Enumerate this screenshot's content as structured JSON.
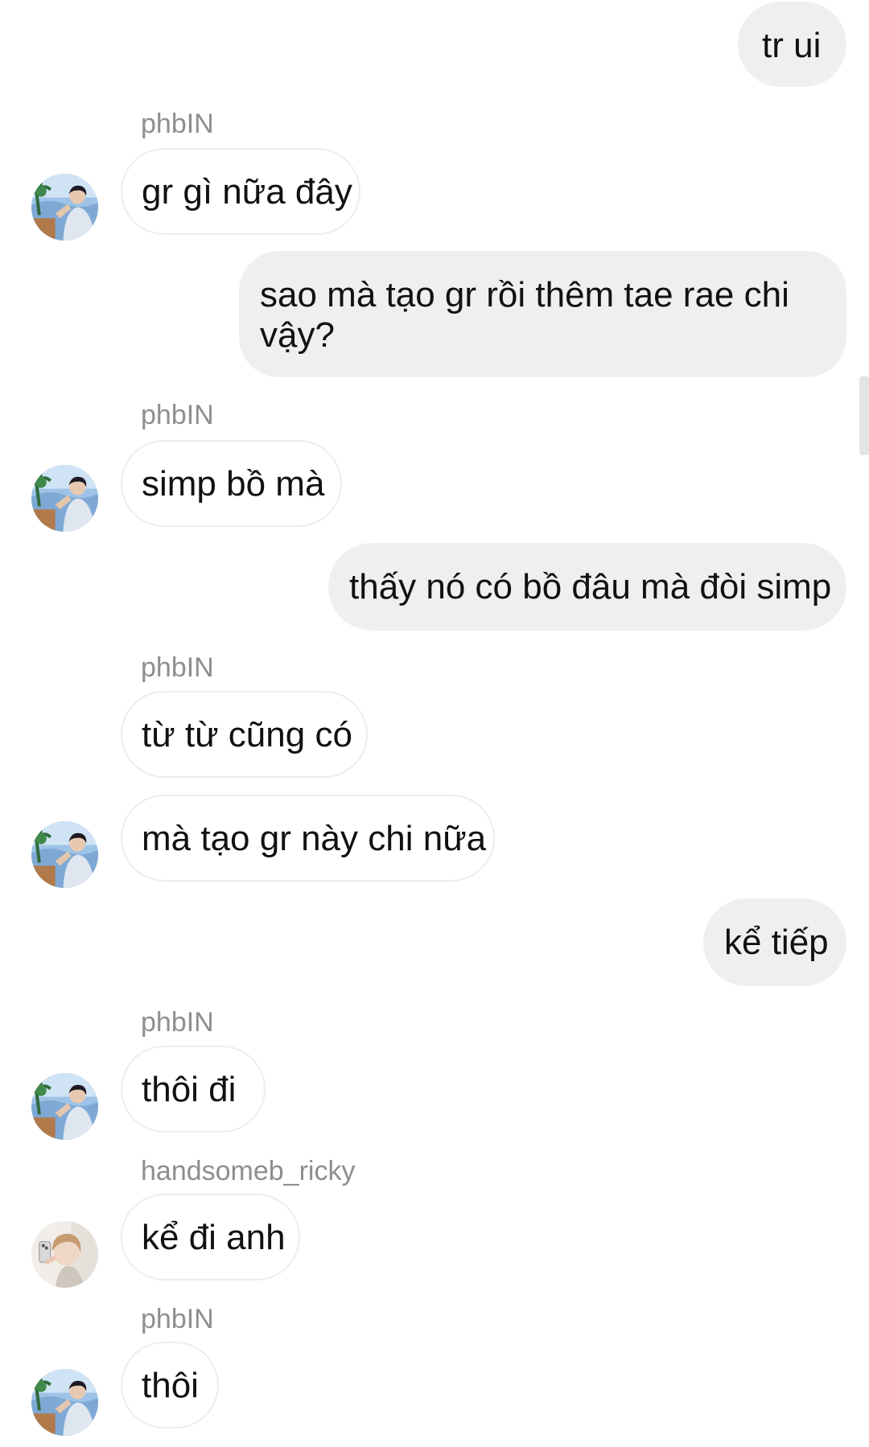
{
  "conversation": {
    "messages": [
      {
        "id": "m1",
        "direction": "outgoing",
        "text": "tr ui"
      },
      {
        "id": "m2",
        "direction": "incoming",
        "sender": "phbIN",
        "text": "gr gì nữa đây"
      },
      {
        "id": "m3",
        "direction": "outgoing",
        "text": "sao mà tạo gr rồi thêm tae rae chi vậy?"
      },
      {
        "id": "m4",
        "direction": "incoming",
        "sender": "phbIN",
        "text": "simp bồ mà"
      },
      {
        "id": "m5",
        "direction": "outgoing",
        "text": "thấy nó có bồ đâu mà đòi simp"
      },
      {
        "id": "m6",
        "direction": "incoming",
        "sender": "phbIN",
        "text": "từ từ cũng có"
      },
      {
        "id": "m7",
        "direction": "incoming",
        "text": "mà tạo gr này chi nữa"
      },
      {
        "id": "m8",
        "direction": "outgoing",
        "text": "kể tiếp"
      },
      {
        "id": "m9",
        "direction": "incoming",
        "sender": "phbIN",
        "text": "thôi đi"
      },
      {
        "id": "m10",
        "direction": "incoming",
        "sender": "handsomeb_ricky",
        "text": "kể đi anh"
      },
      {
        "id": "m11",
        "direction": "incoming",
        "sender": "phbIN",
        "text": "thôi"
      }
    ]
  },
  "colors": {
    "outgoing_bubble": "#efefef",
    "incoming_bubble_border": "#ededed",
    "sender_name": "#8e8e8e",
    "background": "#ffffff"
  },
  "icons": {
    "avatar_phbin": "avatar-phbin-photo",
    "avatar_ricky": "avatar-ricky-photo"
  }
}
